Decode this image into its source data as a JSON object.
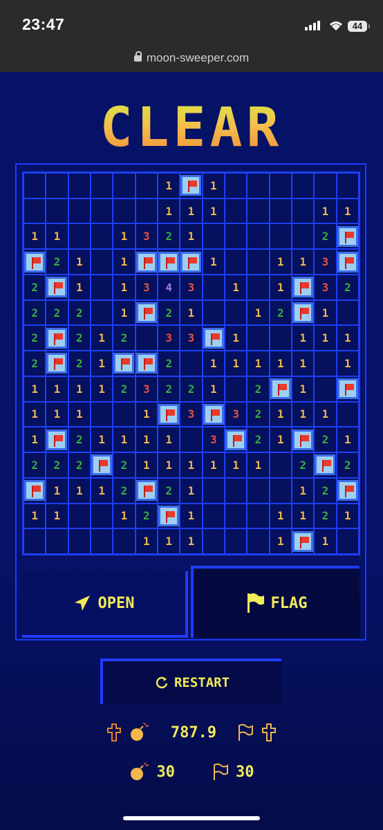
{
  "status_bar": {
    "time": "23:47",
    "battery": "44"
  },
  "browser": {
    "url": "moon-sweeper.com"
  },
  "game": {
    "title": "CLEAR",
    "board": [
      "      1F1      ",
      "      111    11",
      "11  1321     2F",
      "F21 1FFF1  113F",
      "2F1 1343 1 1F32",
      "222 1F21  12F1 ",
      "2F212 33F1  111",
      "2F21FF2 11111 11",
      "111123221 2F1 F",
      "111  1F3F32111 ",
      "1F21111 3F21F21",
      "222F2111111 2F21",
      "F1112F21    12F",
      "11  12F1   1121",
      "     111   1F1 "
    ],
    "buttons": {
      "open": "OPEN",
      "flag": "FLAG",
      "restart": "RESTART"
    },
    "stats": {
      "time": "787.9",
      "mines": "30",
      "flags": "30"
    }
  },
  "colors": {
    "n1": "#f2b84b",
    "n2": "#3cae3c",
    "n3": "#e8533c",
    "n4": "#a07de8",
    "accent": "#f1ea5a",
    "grid": "#1d3ff5"
  }
}
